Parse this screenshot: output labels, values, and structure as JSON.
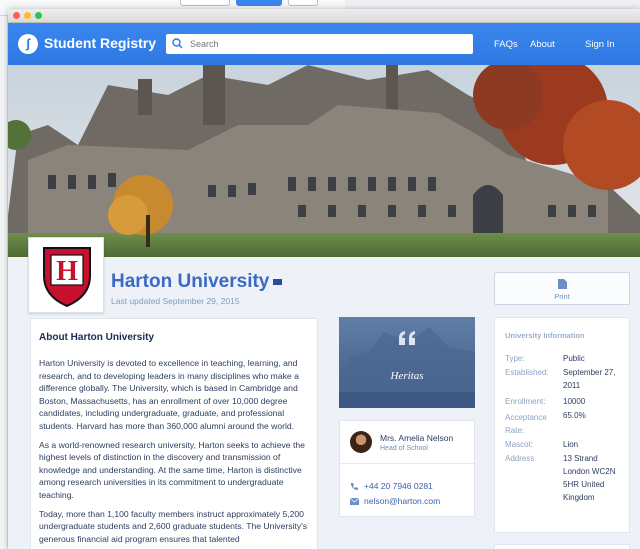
{
  "app": {
    "brand": "Student Registry"
  },
  "search": {
    "placeholder": "Search",
    "value": ""
  },
  "nav": {
    "faqs": "FAQs",
    "about": "About",
    "signin": "Sign In"
  },
  "crest": {
    "letter": "H"
  },
  "university": {
    "name": "Harton University",
    "updated": "Last updated September 29, 2015"
  },
  "print": {
    "label": "Print"
  },
  "about": {
    "title": "About Harton University",
    "paragraphs": [
      "Harton University is devoted to excellence in teaching, learning, and research, and to developing leaders in many disciplines who make a difference globally. The University, which is based in Cambridge and Boston, Massachusetts, has an enrollment of over 10,000 degree candidates, including undergraduate, graduate, and professional students. Harvard has more than 360,000 alumni around the world.",
      "As a world-renowned research university, Harton seeks to achieve the highest levels of distinction in the discovery and transmission of knowledge and understanding. At the same time, Harton is distinctive among research universities in its commitment to undergraduate teaching.",
      "Today, more than 1,100 faculty members instruct approximately 5,200 undergraduate students and 2,600 graduate students. The University's generous financial aid program ensures that talented"
    ]
  },
  "quote": {
    "caption": "Heritas"
  },
  "contact": {
    "name": "Mrs. Amelia Nelson",
    "role": "Head of School",
    "phone": "+44 20 7946 0281",
    "email": "nelson@harton.com"
  },
  "info": {
    "title": "University Information",
    "type_label": "Type:",
    "type": "Public",
    "established_label": "Established:",
    "established": "September 27, 2011",
    "enrollment_label": "Enrollment:",
    "enrollment": "10000",
    "acceptance_label": "Acceptance Rate:",
    "acceptance": "65.0%",
    "mascot_label": "Mascot:",
    "mascot": "Lion",
    "address_label": "Address",
    "address": "13 Strand London WC2N 5HR United Kingdom"
  },
  "colors": {
    "accent": "#2f78e2",
    "heading": "#3a6bc1",
    "crest": "#c8102e"
  }
}
